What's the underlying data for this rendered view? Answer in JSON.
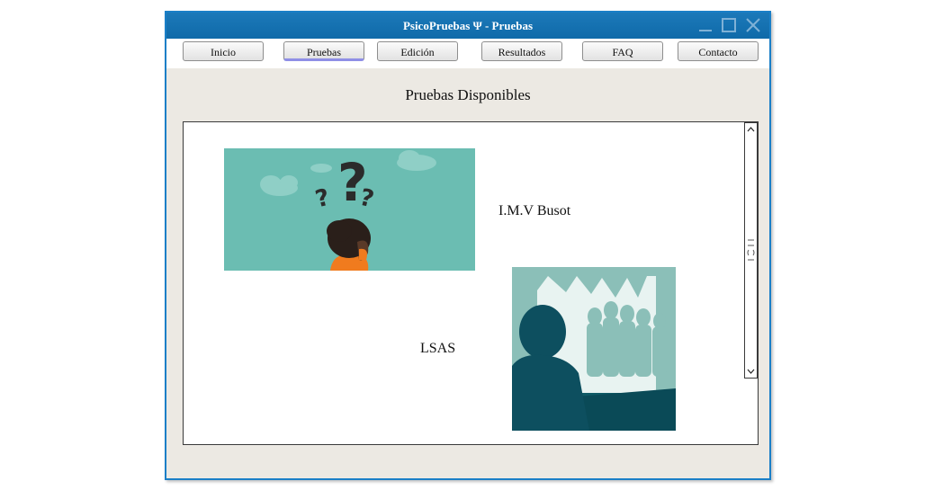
{
  "window": {
    "title": "PsicoPruebas Ψ - Pruebas"
  },
  "menu": {
    "tabs": [
      {
        "label": "Inicio"
      },
      {
        "label": "Pruebas"
      },
      {
        "label": "Edición"
      },
      {
        "label": "Resultados"
      },
      {
        "label": "FAQ"
      },
      {
        "label": "Contacto"
      }
    ],
    "active_tab": "Pruebas"
  },
  "main": {
    "heading": "Pruebas Disponibles",
    "tests": [
      {
        "name": "I.M.V Busot",
        "image_icon": "question-person-image"
      },
      {
        "name": "LSAS",
        "image_icon": "crowd-silhouette-image"
      }
    ]
  },
  "colors": {
    "titlebar": "#1c79b9",
    "window_border": "#1a7fc7",
    "window_bg": "#ece9e3",
    "active_tab_indicator": "#8f8fe6",
    "teal_image_bg": "#6bbdb2",
    "dark_teal": "#0d4f5f"
  }
}
